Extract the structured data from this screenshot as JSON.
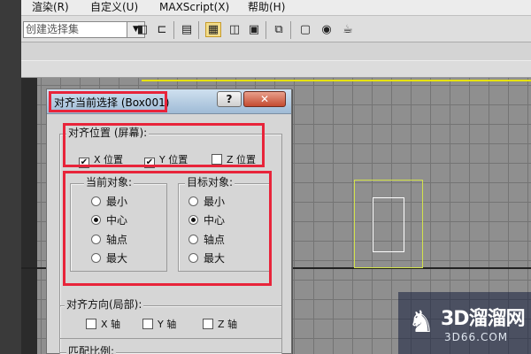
{
  "menu": {
    "items": [
      "渲染(R)",
      "自定义(U)",
      "MAXScript(X)",
      "帮助(H)"
    ]
  },
  "toolbar": {
    "selection_set_placeholder": "创建选择集"
  },
  "dialog": {
    "title": "对齐当前选择 (Box001)",
    "help_label": "?",
    "close_label": "✕",
    "align_position": {
      "label": "对齐位置 (屏幕):",
      "x_label": "X 位置",
      "x_checked": true,
      "y_label": "Y 位置",
      "y_checked": true,
      "z_label": "Z 位置",
      "z_checked": false
    },
    "current_object": {
      "label": "当前对象:",
      "options": [
        "最小",
        "中心",
        "轴点",
        "最大"
      ],
      "selected": "中心"
    },
    "target_object": {
      "label": "目标对象:",
      "options": [
        "最小",
        "中心",
        "轴点",
        "最大"
      ],
      "selected": "中心"
    },
    "align_orientation": {
      "label": "对齐方向(局部):",
      "x_label": "X 轴",
      "y_label": "Y 轴",
      "z_label": "Z 轴"
    },
    "match_scale_label": "匹配比例:"
  },
  "watermark": {
    "title": "3D溜溜网",
    "url": "3D66.COM"
  },
  "colors": {
    "highlight_red": "#e8243a",
    "viewport_bg": "#8f8f8f",
    "selection_white": "#ffffff",
    "box_yellow": "#d3e34a"
  }
}
